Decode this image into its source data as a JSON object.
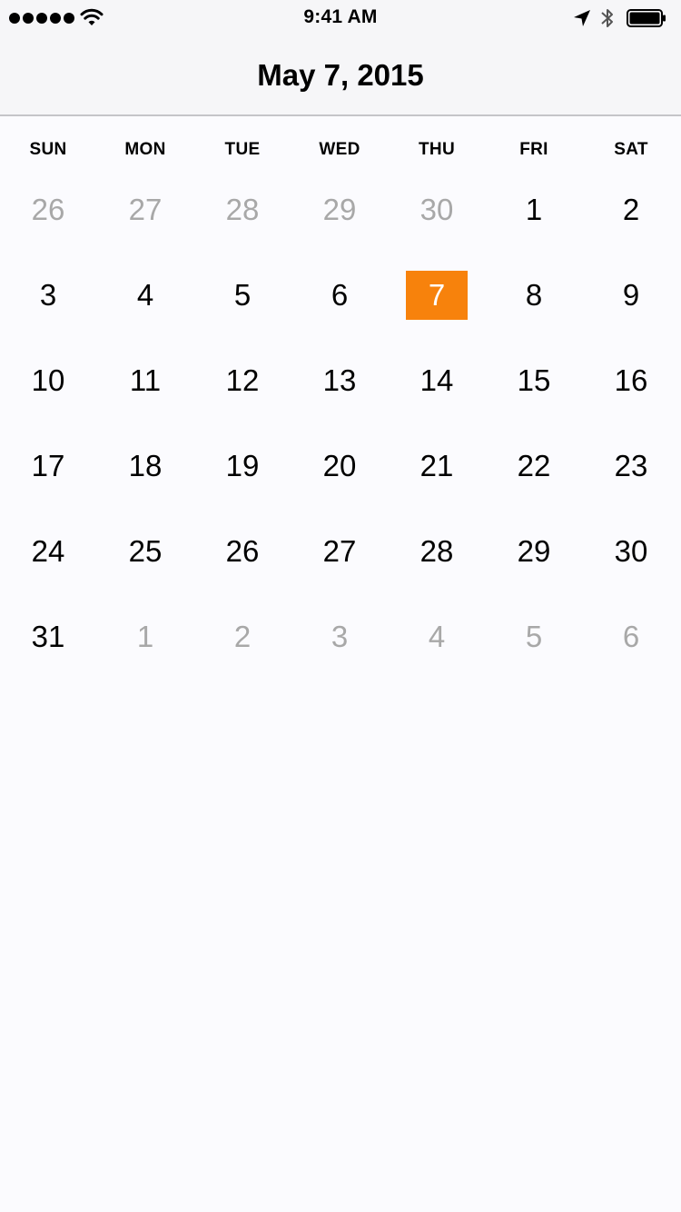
{
  "status_bar": {
    "time": "9:41 AM",
    "signal_icon": "signal-dots-icon",
    "wifi_icon": "wifi-icon",
    "location_icon": "location-arrow-icon",
    "bluetooth_icon": "bluetooth-icon",
    "battery_icon": "battery-icon"
  },
  "header": {
    "title": "May 7, 2015"
  },
  "calendar": {
    "accent_color": "#f7820c",
    "muted_color": "#a8a8a8",
    "weekdays": [
      "SUN",
      "MON",
      "TUE",
      "WED",
      "THU",
      "FRI",
      "SAT"
    ],
    "weeks": [
      [
        {
          "label": "26",
          "muted": true
        },
        {
          "label": "27",
          "muted": true
        },
        {
          "label": "28",
          "muted": true
        },
        {
          "label": "29",
          "muted": true
        },
        {
          "label": "30",
          "muted": true
        },
        {
          "label": "1"
        },
        {
          "label": "2"
        }
      ],
      [
        {
          "label": "3"
        },
        {
          "label": "4"
        },
        {
          "label": "5"
        },
        {
          "label": "6"
        },
        {
          "label": "7",
          "selected": true
        },
        {
          "label": "8"
        },
        {
          "label": "9"
        }
      ],
      [
        {
          "label": "10"
        },
        {
          "label": "11"
        },
        {
          "label": "12"
        },
        {
          "label": "13"
        },
        {
          "label": "14"
        },
        {
          "label": "15"
        },
        {
          "label": "16"
        }
      ],
      [
        {
          "label": "17"
        },
        {
          "label": "18"
        },
        {
          "label": "19"
        },
        {
          "label": "20"
        },
        {
          "label": "21"
        },
        {
          "label": "22"
        },
        {
          "label": "23"
        }
      ],
      [
        {
          "label": "24"
        },
        {
          "label": "25"
        },
        {
          "label": "26"
        },
        {
          "label": "27"
        },
        {
          "label": "28"
        },
        {
          "label": "29"
        },
        {
          "label": "30"
        }
      ],
      [
        {
          "label": "31"
        },
        {
          "label": "1",
          "muted": true
        },
        {
          "label": "2",
          "muted": true
        },
        {
          "label": "3",
          "muted": true
        },
        {
          "label": "4",
          "muted": true
        },
        {
          "label": "5",
          "muted": true
        },
        {
          "label": "6",
          "muted": true
        }
      ]
    ]
  }
}
